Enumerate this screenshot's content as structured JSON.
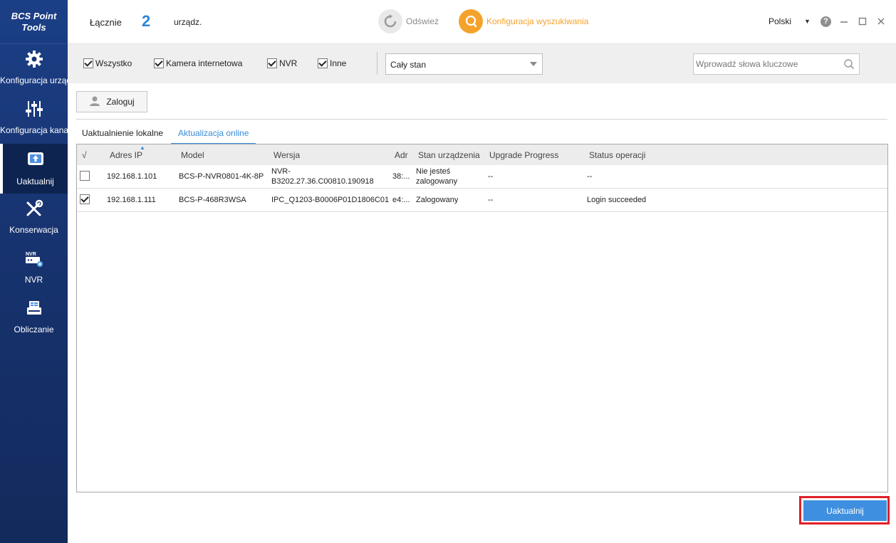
{
  "app": {
    "logo_line1": "BCS Point",
    "logo_line2": "Tools",
    "accent_color": "#2e86d6",
    "sidebar_color": "#17336f"
  },
  "sidebar": {
    "items": [
      {
        "label": "Konfiguracja urządzeń",
        "icon": "gear-icon",
        "active": false
      },
      {
        "label": "Konfiguracja kanału",
        "icon": "sliders-icon",
        "active": false
      },
      {
        "label": "Uaktualnij",
        "icon": "upgrade-icon",
        "active": true
      },
      {
        "label": "Konserwacja",
        "icon": "tools-icon",
        "active": false
      },
      {
        "label": "NVR",
        "icon": "nvr-icon",
        "active": false
      },
      {
        "label": "Obliczanie",
        "icon": "calculator-icon",
        "active": false
      }
    ]
  },
  "header": {
    "total_label": "Łącznie",
    "total_count": "2",
    "total_unit": "urządz.",
    "refresh_label": "Odśwież",
    "search_config_label": "Konfiguracja wyszukiwania",
    "language": "Polski"
  },
  "filters": {
    "all": {
      "label": "Wszystko",
      "checked": true
    },
    "ipcam": {
      "label": "Kamera internetowa",
      "checked": true
    },
    "nvr": {
      "label": "NVR",
      "checked": true
    },
    "other": {
      "label": "Inne",
      "checked": true
    },
    "state_select": "Cały stan",
    "keyword_placeholder": "Wprowadź słowa kluczowe"
  },
  "toolbar": {
    "login_label": "Zaloguj"
  },
  "tabs": {
    "local": "Uaktualnienie lokalne",
    "online": "Aktualizacja online"
  },
  "table": {
    "headers": {
      "check": "√",
      "ip": "Adres IP",
      "model": "Model",
      "version": "Wersja",
      "addr": "Adr",
      "state": "Stan urządzenia",
      "progress": "Upgrade Progress",
      "status": "Status operacji"
    },
    "rows": [
      {
        "checked": false,
        "ip": "192.168.1.101",
        "model": "BCS-P-NVR0801-4K-8P",
        "version_l1": "NVR-",
        "version_l2": "B3202.27.36.C00810.190918",
        "addr": "38:...",
        "state_l1": "Nie jesteś",
        "state_l2": "zalogowany",
        "progress": "--",
        "status": "--"
      },
      {
        "checked": true,
        "ip": "192.168.1.111",
        "model": "BCS-P-468R3WSA",
        "version_l1": "IPC_Q1203-B0006P01D1806C01",
        "version_l2": "",
        "addr": "e4:...",
        "state_l1": "Zalogowany",
        "state_l2": "",
        "progress": "--",
        "status": "Login succeeded"
      }
    ]
  },
  "footer": {
    "update_label": "Uaktualnij",
    "highlight_color": "#e0202a"
  }
}
